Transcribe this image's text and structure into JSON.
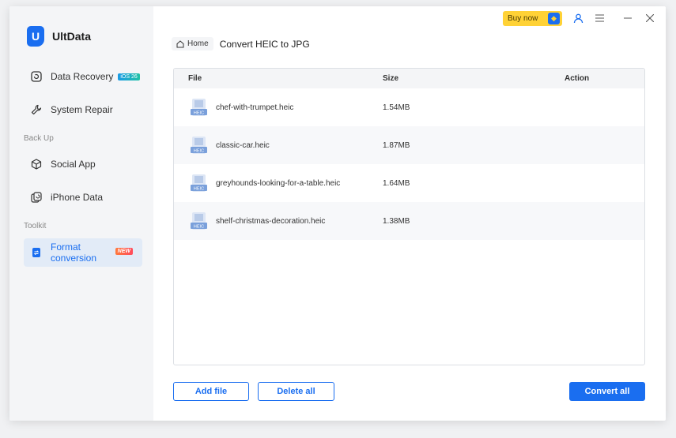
{
  "app": {
    "name": "UltData"
  },
  "sidebar": {
    "items": [
      {
        "label": "Data Recovery",
        "badge": "iOS 26",
        "icon": "recovery-icon"
      },
      {
        "label": "System Repair",
        "icon": "wrench-icon"
      },
      {
        "label": "Social App",
        "icon": "cube-icon"
      },
      {
        "label": "iPhone Data",
        "icon": "phone-data-icon"
      },
      {
        "label": "Format conversion",
        "badge": "NEW",
        "icon": "convert-icon",
        "active": true
      }
    ],
    "sections": {
      "backup": "Back Up",
      "toolkit": "Toolkit"
    }
  },
  "topbar": {
    "buy_now": "Buy now"
  },
  "breadcrumb": {
    "home": "Home",
    "title": "Convert HEIC to JPG"
  },
  "table": {
    "headers": {
      "file": "File",
      "size": "Size",
      "action": "Action"
    },
    "rows": [
      {
        "name": "chef-with-trumpet.heic",
        "size": "1.54MB"
      },
      {
        "name": "classic-car.heic",
        "size": "1.87MB"
      },
      {
        "name": "greyhounds-looking-for-a-table.heic",
        "size": "1.64MB"
      },
      {
        "name": "shelf-christmas-decoration.heic",
        "size": "1.38MB"
      }
    ],
    "file_icon_label": "HEIC"
  },
  "buttons": {
    "add_file": "Add file",
    "delete_all": "Delete all",
    "convert_all": "Convert all"
  },
  "colors": {
    "accent": "#1a6ef0",
    "buy_now": "#ffd236"
  }
}
